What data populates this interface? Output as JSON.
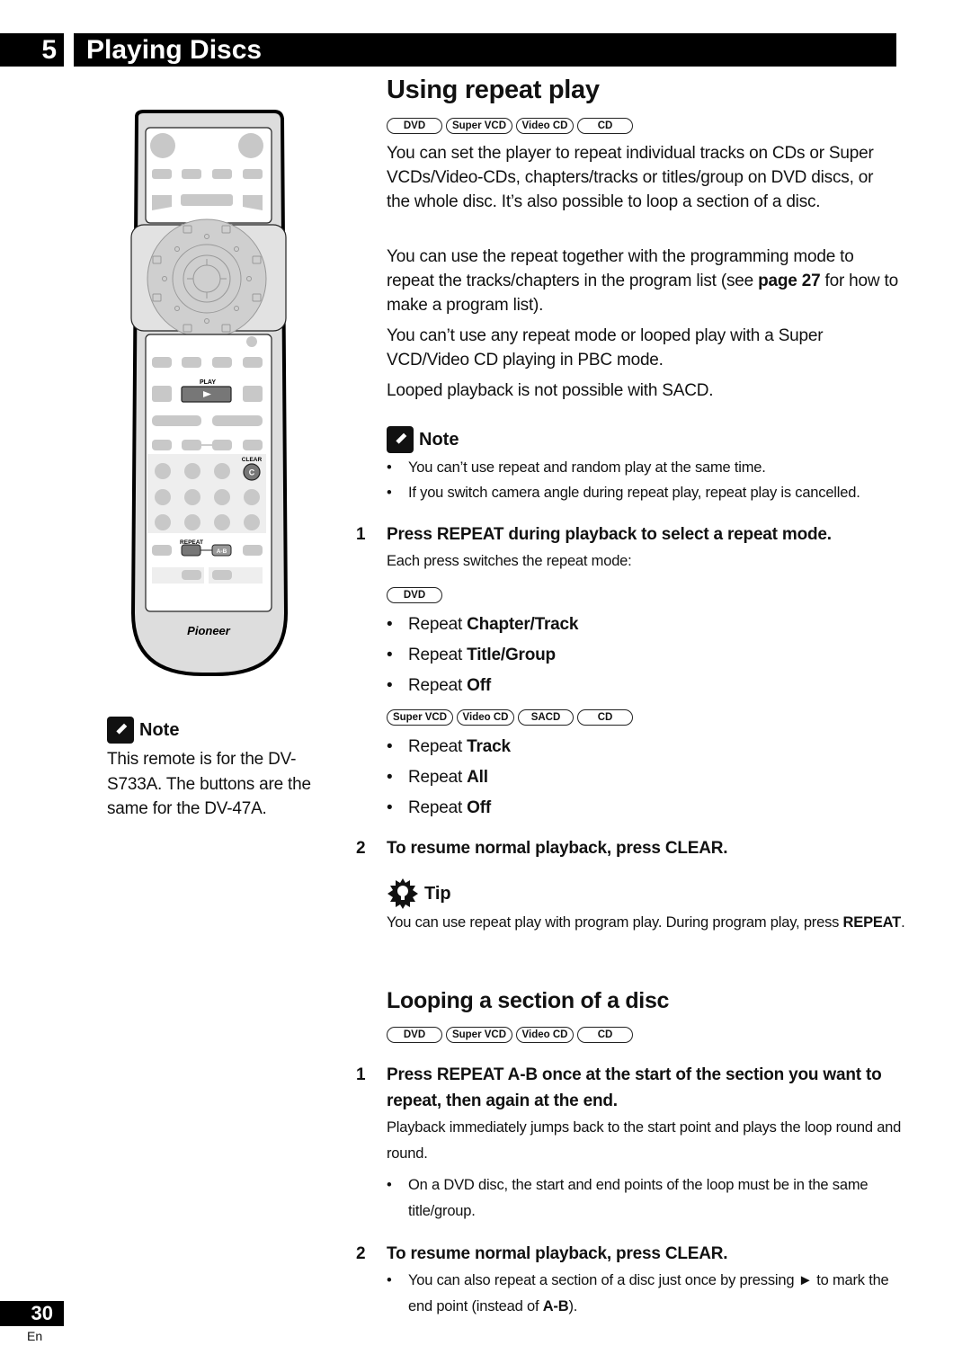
{
  "header": {
    "chapter_number": "5",
    "chapter_title": "Playing Discs"
  },
  "remote": {
    "play_label": "PLAY",
    "clear_label": "CLEAR",
    "clear_key": "C",
    "repeat_label": "REPEAT",
    "ab_key": "A-B",
    "brand": "Pioneer"
  },
  "left_note": {
    "heading": "Note",
    "text": "This remote is for the DV-S733A. The buttons are the same for the DV-47A."
  },
  "section1": {
    "title": "Using repeat play",
    "badges": [
      "DVD",
      "Super VCD",
      "Video CD",
      "CD"
    ],
    "paragraphs": [
      "You can set the player to repeat individual tracks on CDs or Super VCDs/Video-CDs, chapters/tracks or titles/group on DVD discs, or the whole disc. It’s also possible to loop a section of a disc.",
      "Looped playback is not possible with SACD.",
      "You can’t use any repeat mode or looped play with a Super VCD/Video CD playing in PBC mode."
    ],
    "para2_before": "You can use the repeat together with the programming mode to repeat the tracks/chapters in the program list (see ",
    "para2_link": "page 27",
    "para2_after": " for how to make a program list).",
    "note": {
      "heading": "Note",
      "items": [
        "You can’t use repeat and random play at the same time.",
        "If you switch camera angle during repeat play, repeat play is cancelled."
      ]
    },
    "step1": {
      "number": "1",
      "title": "Press REPEAT during playback to select a repeat mode.",
      "desc": "Each press switches the repeat mode:",
      "dvd_badges": [
        "DVD"
      ],
      "dvd_modes": [
        {
          "prefix": "Repeat ",
          "mode": "Chapter/Track"
        },
        {
          "prefix": "Repeat ",
          "mode": "Title/Group"
        },
        {
          "prefix": "Repeat ",
          "mode": "Off"
        }
      ],
      "cd_badges": [
        "Super VCD",
        "Video CD",
        "SACD",
        "CD"
      ],
      "cd_modes": [
        {
          "prefix": "Repeat ",
          "mode": "Track"
        },
        {
          "prefix": "Repeat ",
          "mode": "All"
        },
        {
          "prefix": "Repeat ",
          "mode": "Off"
        }
      ]
    },
    "step2": {
      "number": "2",
      "title": "To resume normal playback, press CLEAR."
    },
    "tip": {
      "heading": "Tip",
      "text": "You can use repeat play with program play. During program play, press ",
      "bold": "REPEAT",
      "end": "."
    }
  },
  "section2": {
    "title": "Looping a section of a disc",
    "badges": [
      "DVD",
      "Super VCD",
      "Video CD",
      "CD"
    ],
    "step1": {
      "number": "1",
      "title": "Press REPEAT A-B  once at the start of the section you want to repeat, then again at the end.",
      "desc": "Playback immediately jumps back to the start point and plays the loop round and round.",
      "bullet": "On a DVD disc, the start and end points of the loop must be in the same title/group."
    },
    "step2": {
      "number": "2",
      "title": "To resume normal playback, press CLEAR.",
      "bullet_before": "You can also repeat a section of a disc just once by pressing ► to mark the end point (instead of ",
      "bullet_bold": "A-B",
      "bullet_after": ")."
    }
  },
  "footer": {
    "page_number": "30",
    "language": "En"
  }
}
